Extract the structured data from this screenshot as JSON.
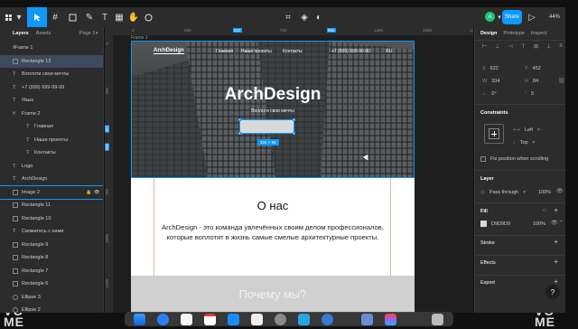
{
  "toolbar": {
    "share_label": "Share",
    "zoom": "44%",
    "avatar_initial": "A"
  },
  "left_panel": {
    "tabs": [
      "Layers",
      "Assets"
    ],
    "page": "Page 1",
    "layers": [
      {
        "name": "Frame 1",
        "kind": "frame",
        "level": 0
      },
      {
        "name": "Rectangle 12",
        "kind": "rect",
        "level": 1,
        "selected": true
      },
      {
        "name": "Воплоти свои мечты",
        "kind": "text",
        "level": 1
      },
      {
        "name": "+7 (999) 999-99-99",
        "kind": "text",
        "level": 1
      },
      {
        "name": "Язык",
        "kind": "text",
        "level": 1
      },
      {
        "name": "Frame 2",
        "kind": "frame",
        "level": 1
      },
      {
        "name": "Главная",
        "kind": "text",
        "level": 2
      },
      {
        "name": "Наши проекты",
        "kind": "text",
        "level": 2
      },
      {
        "name": "Контакты",
        "kind": "text",
        "level": 2
      },
      {
        "name": "Logo",
        "kind": "text",
        "level": 1
      },
      {
        "name": "ArchDesign",
        "kind": "text",
        "level": 1
      },
      {
        "name": "Image 2",
        "kind": "image",
        "level": 1
      },
      {
        "name": "Rectangle 11",
        "kind": "rect",
        "level": 1
      },
      {
        "name": "Rectangle 10",
        "kind": "rect",
        "level": 1
      },
      {
        "name": "Свяжитесь с нами",
        "kind": "text",
        "level": 1
      },
      {
        "name": "Rectangle 9",
        "kind": "rect",
        "level": 1
      },
      {
        "name": "Rectangle 8",
        "kind": "rect",
        "level": 1
      },
      {
        "name": "Rectangle 7",
        "kind": "rect",
        "level": 1
      },
      {
        "name": "Rectangle 6",
        "kind": "rect",
        "level": 1
      },
      {
        "name": "Ellipse 3",
        "kind": "ellipse",
        "level": 1
      },
      {
        "name": "Ellipse 2",
        "kind": "ellipse",
        "level": 1
      }
    ]
  },
  "canvas": {
    "ruler_marks": [
      "0",
      "250",
      "622",
      "750",
      "956",
      "1250",
      "1500",
      "1750",
      "2"
    ],
    "ruler_marks_v": [
      "0",
      "250",
      "452",
      "536",
      "750",
      "1000",
      "1250",
      "1500"
    ],
    "frame_label": "Frame 1",
    "site": {
      "logo": "ArchDesign",
      "nav": [
        "Главная",
        "Наши проекты",
        "Контакты"
      ],
      "phone": "+7 (909) 990-90-90",
      "lang": "RU",
      "hero_title": "ArchDesign",
      "hero_subtitle": "Воплоти свои мечты",
      "size_badge": "334 × 84",
      "about_title": "О нас",
      "about_text": "ArchDesign - это команда увлечённых своим делом профессионалов, которые воплотят в жизнь самые смелые архитектурные проекты.",
      "why_title": "Почему мы?"
    }
  },
  "right_panel": {
    "tabs": [
      "Design",
      "Prototype",
      "Inspect"
    ],
    "x": "622",
    "y": "452",
    "w": "334",
    "h": "84",
    "rotation": "0°",
    "radius": "5",
    "constraints_title": "Constraints",
    "h_constraint": "Left",
    "v_constraint": "Top",
    "fix_position": "Fix position when scrolling",
    "layer_title": "Layer",
    "blend": "Pass through",
    "layer_opacity": "100%",
    "fill_title": "Fill",
    "fill_hex": "D9D9D9",
    "fill_opacity": "100%",
    "stroke_title": "Stroke",
    "effects_title": "Effects",
    "export_title": "Export",
    "help": "?"
  },
  "colors": {
    "accent": "#0d99ff",
    "share": "#0d99ff",
    "avatar": "#1bc47d",
    "fill_swatch": "#d9d9d9"
  },
  "background_text": {
    "left": "VO\nME",
    "right": "VO\nME"
  }
}
